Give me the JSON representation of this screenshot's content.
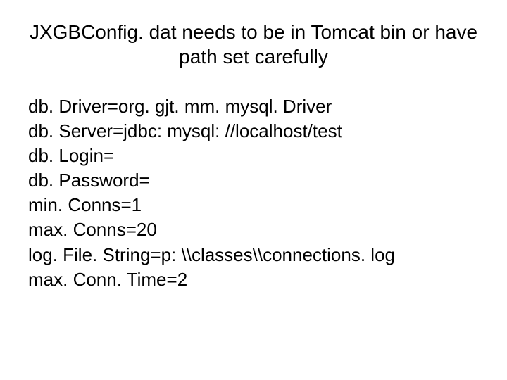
{
  "title": "JXGBConfig. dat needs to be in Tomcat bin or have path set carefully",
  "config_lines": [
    "db. Driver=org. gjt. mm. mysql. Driver",
    "db. Server=jdbc: mysql: //localhost/test",
    "db. Login=",
    "db. Password=",
    "min. Conns=1",
    "max. Conns=20",
    "log. File. String=p: \\\\classes\\\\connections. log",
    "max. Conn. Time=2"
  ]
}
